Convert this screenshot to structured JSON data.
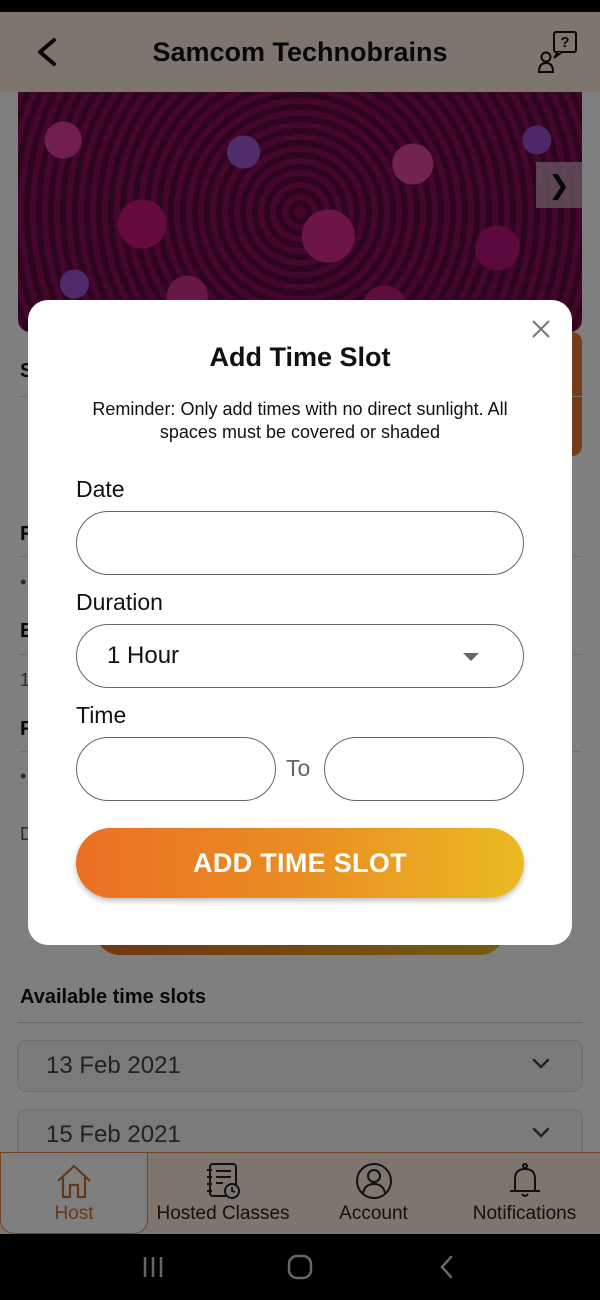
{
  "header": {
    "title": "Samcom Technobrains",
    "back_icon": "chevron-left-icon",
    "help_icon": "user-question-icon"
  },
  "hero": {
    "next_glyph": "❯"
  },
  "background": {
    "letters": [
      "S",
      "F",
      "•",
      "E",
      "1",
      "F",
      "•",
      "D"
    ],
    "available_title": "Available time slots",
    "slots": [
      {
        "date": "13 Feb 2021"
      },
      {
        "date": "15 Feb 2021"
      }
    ]
  },
  "modal": {
    "title": "Add Time Slot",
    "reminder": "Reminder: Only add times with no direct sunlight. All spaces must be covered or shaded",
    "date_label": "Date",
    "date_value": "",
    "duration_label": "Duration",
    "duration_value": "1 Hour",
    "time_label": "Time",
    "time_from_value": "",
    "time_to_value": "",
    "to_label": "To",
    "submit_label": "ADD TIME SLOT"
  },
  "bottom_nav": {
    "items": [
      {
        "label": "Host",
        "icon": "home-icon",
        "active": true
      },
      {
        "label": "Hosted Classes",
        "icon": "notebook-clock-icon",
        "active": false
      },
      {
        "label": "Account",
        "icon": "user-circle-icon",
        "active": false
      },
      {
        "label": "Notifications",
        "icon": "bell-icon",
        "active": false
      }
    ]
  },
  "colors": {
    "accent_orange": "#ea6f23",
    "accent_yellow": "#eabb22",
    "header_bg": "#fbeadc",
    "active_nav_text": "#c9702e"
  }
}
